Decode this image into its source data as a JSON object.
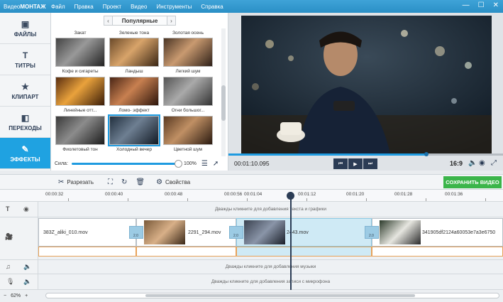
{
  "titlebar": {
    "logo_prefix": "Видео",
    "logo_brand": "МОНТАЖ",
    "menu": [
      "Файл",
      "Правка",
      "Проект",
      "Видео",
      "Инструменты",
      "Справка"
    ]
  },
  "sidebar": {
    "items": [
      {
        "label": "ФАЙЛЫ",
        "icon": "image-icon"
      },
      {
        "label": "ТИТРЫ",
        "icon": "text-icon"
      },
      {
        "label": "КЛИПАРТ",
        "icon": "star-icon"
      },
      {
        "label": "ПЕРЕХОДЫ",
        "icon": "layers-icon"
      },
      {
        "label": "ЭФФЕКТЫ",
        "icon": "wand-icon",
        "active": true
      }
    ]
  },
  "gallery": {
    "category": "Популярные",
    "row_top_labels": [
      "Закат",
      "Зеленые тона",
      "Золотая осень"
    ],
    "effects": [
      {
        "label": "Кофе и сигареты",
        "tone": "bw"
      },
      {
        "label": "Ландыш",
        "tone": "warm"
      },
      {
        "label": "Легкий шум",
        "tone": "warm"
      },
      {
        "label": "Линейные отт...",
        "tone": "sepia"
      },
      {
        "label": "Ломо- эффект",
        "tone": "warm"
      },
      {
        "label": "Огни большог...",
        "tone": "gray"
      },
      {
        "label": "Фиолетовый тон",
        "tone": "bw"
      },
      {
        "label": "Холодный вечер",
        "tone": "cool",
        "selected": true
      },
      {
        "label": "Цветной шум",
        "tone": "warm"
      }
    ],
    "strength_label": "Сила:",
    "strength_value": 100,
    "strength_text": "100%"
  },
  "preview": {
    "timecode": "00:01:10.095",
    "ratio": "16:9",
    "progress": 0.72
  },
  "toolbar": {
    "cut_label": "Разрезать",
    "props_label": "Свойства",
    "save_label": "СОХРАНИТЬ ВИДЕО"
  },
  "ruler": {
    "ticks": [
      "00:00:32",
      "00:00:40",
      "00:00:48",
      "00:00:56",
      "00:01:04",
      "00:01:12",
      "00:01:20",
      "00:01:28",
      "00:01:36"
    ]
  },
  "timeline": {
    "text_hint": "Дважды кликните для добавления текста и графики",
    "music_hint": "Дважды кликните для добавления музыки",
    "mic_hint": "Дважды кликните для добавления записи с микрофона",
    "clips": [
      {
        "name": "383Z_aliki_010.mov"
      },
      {
        "name": "2291_294.mov"
      },
      {
        "name": "2443.mov"
      },
      {
        "name": "341905df2124a60053e7a3e6750"
      }
    ],
    "transition_labels": [
      "2.0",
      "2.0",
      "2.0",
      "2.0"
    ],
    "zoom": "62%"
  },
  "colors": {
    "accent": "#1fa2e1",
    "save": "#3bb54a",
    "titlebar": "#2a8fc6"
  }
}
